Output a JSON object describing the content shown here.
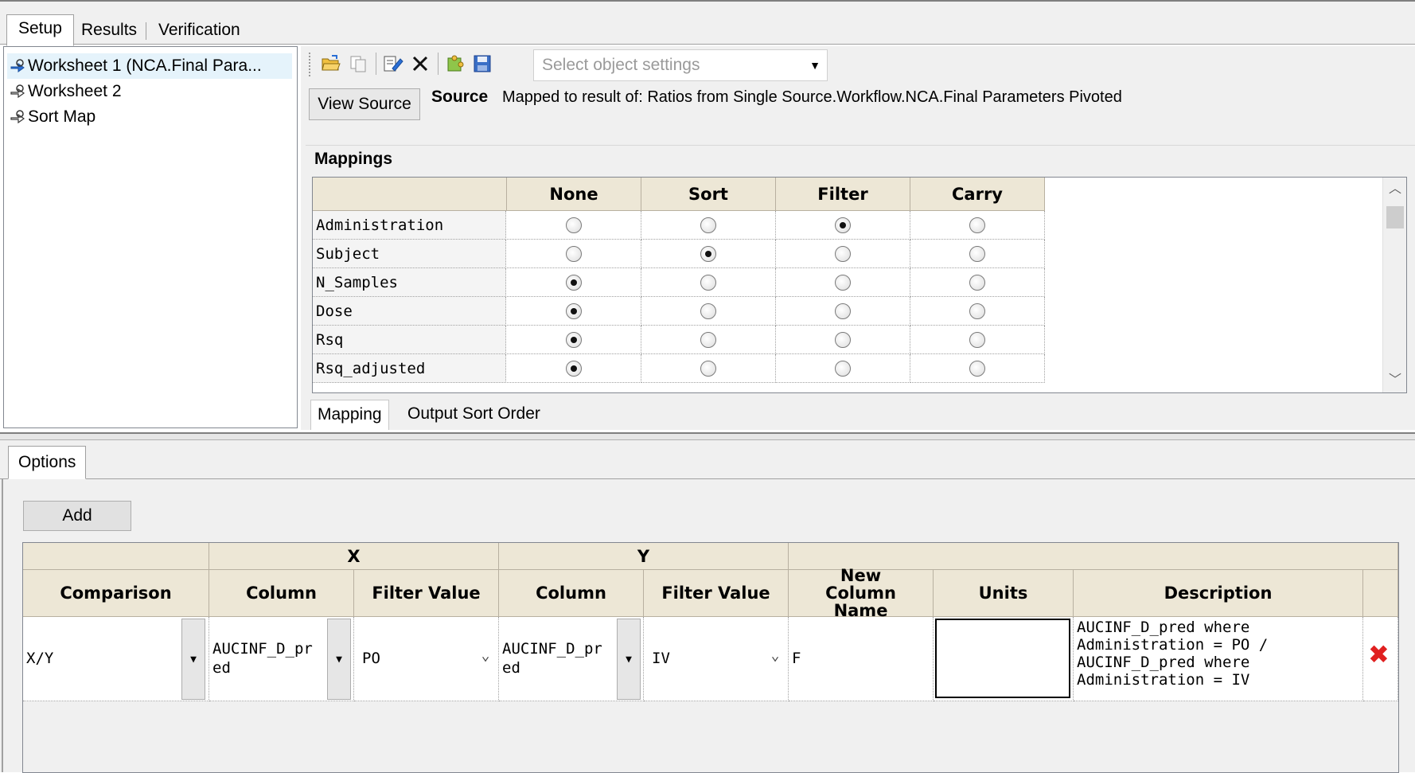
{
  "tabs": [
    "Setup",
    "Results",
    "Verification"
  ],
  "tree": {
    "items": [
      {
        "label": "Worksheet 1 (NCA.Final Para..."
      },
      {
        "label": "Worksheet 2"
      },
      {
        "label": "Sort Map"
      }
    ]
  },
  "toolbar": {
    "select_placeholder": "Select object settings",
    "icons": [
      "open-folder-icon",
      "copy-icon",
      "edit-icon",
      "delete-icon",
      "puzzle-icon",
      "save-icon"
    ]
  },
  "source": {
    "button_label": "View Source",
    "label": "Source",
    "text": "Mapped to result of: Ratios from Single Source.Workflow.NCA.Final Parameters Pivoted"
  },
  "mappings": {
    "title": "Mappings",
    "columns": [
      "None",
      "Sort",
      "Filter",
      "Carry"
    ],
    "rows": [
      {
        "name": "Administration",
        "selected": "Filter"
      },
      {
        "name": "Subject",
        "selected": "Sort"
      },
      {
        "name": "N_Samples",
        "selected": "None"
      },
      {
        "name": "Dose",
        "selected": "None"
      },
      {
        "name": "Rsq",
        "selected": "None"
      },
      {
        "name": "Rsq_adjusted",
        "selected": "None"
      }
    ]
  },
  "subtabs": [
    "Mapping",
    "Output Sort Order"
  ],
  "options": {
    "tab_label": "Options",
    "add_label": "Add",
    "group_headers": {
      "x": "X",
      "y": "Y"
    },
    "headers": {
      "comparison": "Comparison",
      "x_column": "Column",
      "x_filter": "Filter Value",
      "y_column": "Column",
      "y_filter": "Filter Value",
      "new_column": "New Column Name",
      "units": "Units",
      "description": "Description"
    },
    "rows": [
      {
        "comparison": "X/Y",
        "x_column": "AUCINF_D_pred",
        "x_filter": "PO",
        "y_column": "AUCINF_D_pred",
        "y_filter": "IV",
        "new_column": "F",
        "units": "",
        "description": "AUCINF_D_pred where Administration = PO / AUCINF_D_pred where Administration = IV"
      }
    ]
  },
  "colors": {
    "header_bg": "#ede7d6",
    "chrome_bg": "#f0f0f0",
    "delete_red": "#e02020"
  }
}
